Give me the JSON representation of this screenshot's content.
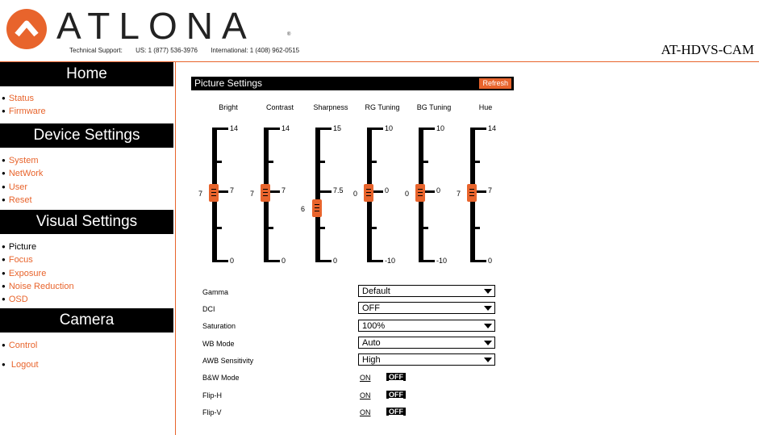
{
  "header": {
    "brand": "ATLONA",
    "support_label": "Technical Support:",
    "support_us": "US: 1 (877) 536-3976",
    "support_intl": "International: 1 (408) 962-0515",
    "model": "AT-HDVS-CAM"
  },
  "sidebar": {
    "home_title": "Home",
    "home_items": [
      "Status",
      "Firmware"
    ],
    "device_title": "Device Settings",
    "device_items": [
      "System",
      "NetWork",
      "User",
      "Reset"
    ],
    "visual_title": "Visual Settings",
    "visual_items": [
      "Picture",
      "Focus",
      "Exposure",
      "Noise Reduction",
      "OSD"
    ],
    "camera_title": "Camera",
    "camera_items": [
      "Control",
      "Logout"
    ]
  },
  "panel": {
    "title": "Picture Settings",
    "refresh": "Refresh"
  },
  "sliders": [
    {
      "label": "Bright",
      "max": "14",
      "mid": "7",
      "min": "0",
      "value": "7"
    },
    {
      "label": "Contrast",
      "max": "14",
      "mid": "7",
      "min": "0",
      "value": "7"
    },
    {
      "label": "Sharpness",
      "max": "15",
      "mid": "7.5",
      "min": "0",
      "value": "6"
    },
    {
      "label": "RG Tuning",
      "max": "10",
      "mid": "0",
      "min": "-10",
      "value": "0"
    },
    {
      "label": "BG Tuning",
      "max": "10",
      "mid": "0",
      "min": "-10",
      "value": "0"
    },
    {
      "label": "Hue",
      "max": "14",
      "mid": "7",
      "min": "0",
      "value": "7"
    }
  ],
  "settings": {
    "gamma": {
      "label": "Gamma",
      "value": "Default"
    },
    "dci": {
      "label": "DCI",
      "value": "OFF"
    },
    "saturation": {
      "label": "Saturation",
      "value": "100%"
    },
    "wb_mode": {
      "label": "WB Mode",
      "value": "Auto"
    },
    "awb_sensitivity": {
      "label": "AWB Sensitivity",
      "value": "High"
    },
    "bw_mode": {
      "label": "B&W Mode",
      "on": "ON",
      "off": "OFF"
    },
    "flip_h": {
      "label": "Flip-H",
      "on": "ON",
      "off": "OFF"
    },
    "flip_v": {
      "label": "Flip-V",
      "on": "ON",
      "off": "OFF"
    }
  },
  "colors": {
    "accent": "#e8642c"
  }
}
